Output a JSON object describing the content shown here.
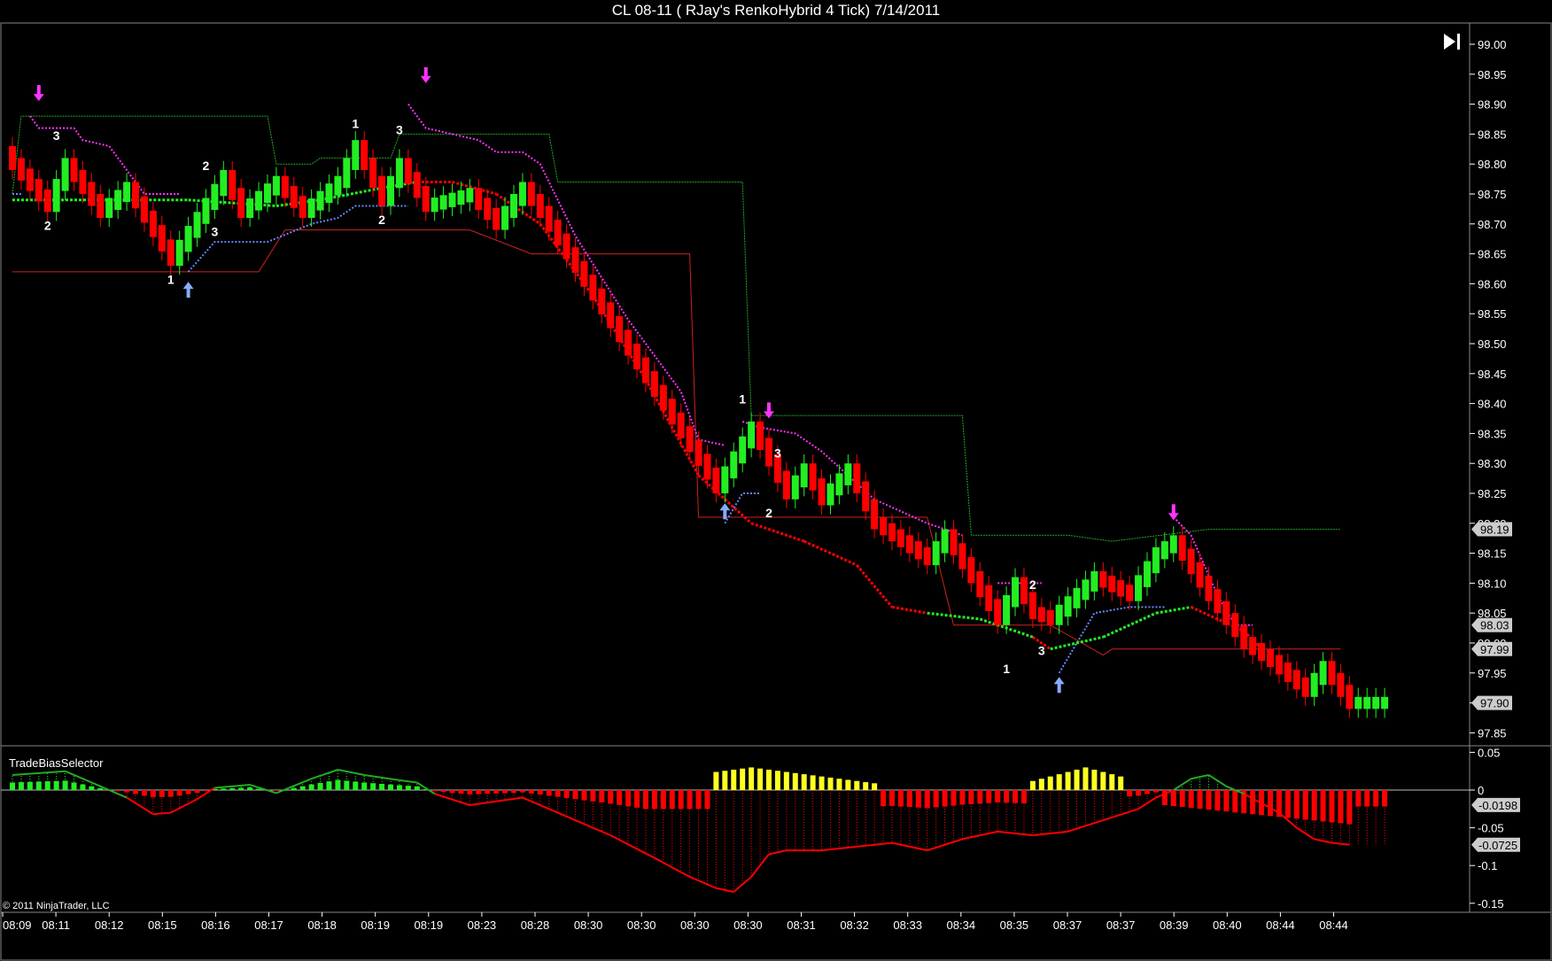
{
  "title": "CL 08-11 ( RJay's RenkoHybrid  4 Tick)  7/14/2011",
  "copyright": "© 2011 NinjaTrader, LLC",
  "indicator_label": "TradeBiasSelector",
  "colors": {
    "up_bar": "#22ee22",
    "down_bar": "#ff0000",
    "magenta": "#ff33ff",
    "blue": "#6688ff",
    "green_line": "#22aa22",
    "dark_red_line": "#cc2222",
    "yellow": "#ffff22"
  },
  "chart_data": [
    {
      "type": "candlestick",
      "name": "price",
      "y_ticks": [
        "99.00",
        "98.95",
        "98.90",
        "98.85",
        "98.80",
        "98.75",
        "98.70",
        "98.65",
        "98.60",
        "98.55",
        "98.50",
        "98.45",
        "98.40",
        "98.35",
        "98.30",
        "98.25",
        "98.20",
        "98.15",
        "98.10",
        "98.05",
        "98.00",
        "97.95",
        "97.90",
        "97.85"
      ],
      "ylim": [
        97.82,
        99.02
      ],
      "x_ticks": [
        "08:09",
        "08:11",
        "08:12",
        "08:15",
        "08:16",
        "08:17",
        "08:18",
        "08:19",
        "08:19",
        "08:23",
        "08:28",
        "08:30",
        "08:30",
        "08:30",
        "08:30",
        "08:31",
        "08:32",
        "08:33",
        "08:34",
        "08:35",
        "08:37",
        "08:37",
        "08:39",
        "08:40",
        "08:44",
        "08:44"
      ],
      "bar_count": 157,
      "price_badges": [
        "98.19",
        "98.03",
        "97.99",
        "97.90"
      ],
      "swing_labels": [
        {
          "text": "3",
          "bar": 5,
          "price": 98.84
        },
        {
          "text": "2",
          "bar": 4,
          "price": 98.69
        },
        {
          "text": "2",
          "bar": 22,
          "price": 98.79
        },
        {
          "text": "3",
          "bar": 23,
          "price": 98.68
        },
        {
          "text": "1",
          "bar": 18,
          "price": 98.6
        },
        {
          "text": "1",
          "bar": 39,
          "price": 98.86
        },
        {
          "text": "3",
          "bar": 44,
          "price": 98.85
        },
        {
          "text": "2",
          "bar": 42,
          "price": 98.7
        },
        {
          "text": "1",
          "bar": 83,
          "price": 98.4
        },
        {
          "text": "3",
          "bar": 87,
          "price": 98.31
        },
        {
          "text": "2",
          "bar": 86,
          "price": 98.21
        },
        {
          "text": "2",
          "bar": 116,
          "price": 98.09
        },
        {
          "text": "1",
          "bar": 113,
          "price": 97.95
        },
        {
          "text": "3",
          "bar": 117,
          "price": 97.98
        }
      ],
      "arrows": [
        {
          "dir": "down",
          "bar": 3,
          "price": 98.92
        },
        {
          "dir": "up",
          "bar": 20,
          "price": 98.59
        },
        {
          "dir": "down",
          "bar": 47,
          "price": 98.95
        },
        {
          "dir": "up",
          "bar": 81,
          "price": 98.22
        },
        {
          "dir": "down",
          "bar": 86,
          "price": 98.39
        },
        {
          "dir": "up",
          "bar": 119,
          "price": 97.93
        },
        {
          "dir": "down",
          "bar": 132,
          "price": 98.22
        }
      ]
    },
    {
      "type": "bar",
      "name": "TradeBiasSelector",
      "y_ticks": [
        "0.05",
        "0",
        "-0.05",
        "-0.1",
        "-0.15"
      ],
      "ylim": [
        -0.155,
        0.055
      ],
      "badges": [
        "-0.0198",
        "-0.0725"
      ]
    }
  ]
}
